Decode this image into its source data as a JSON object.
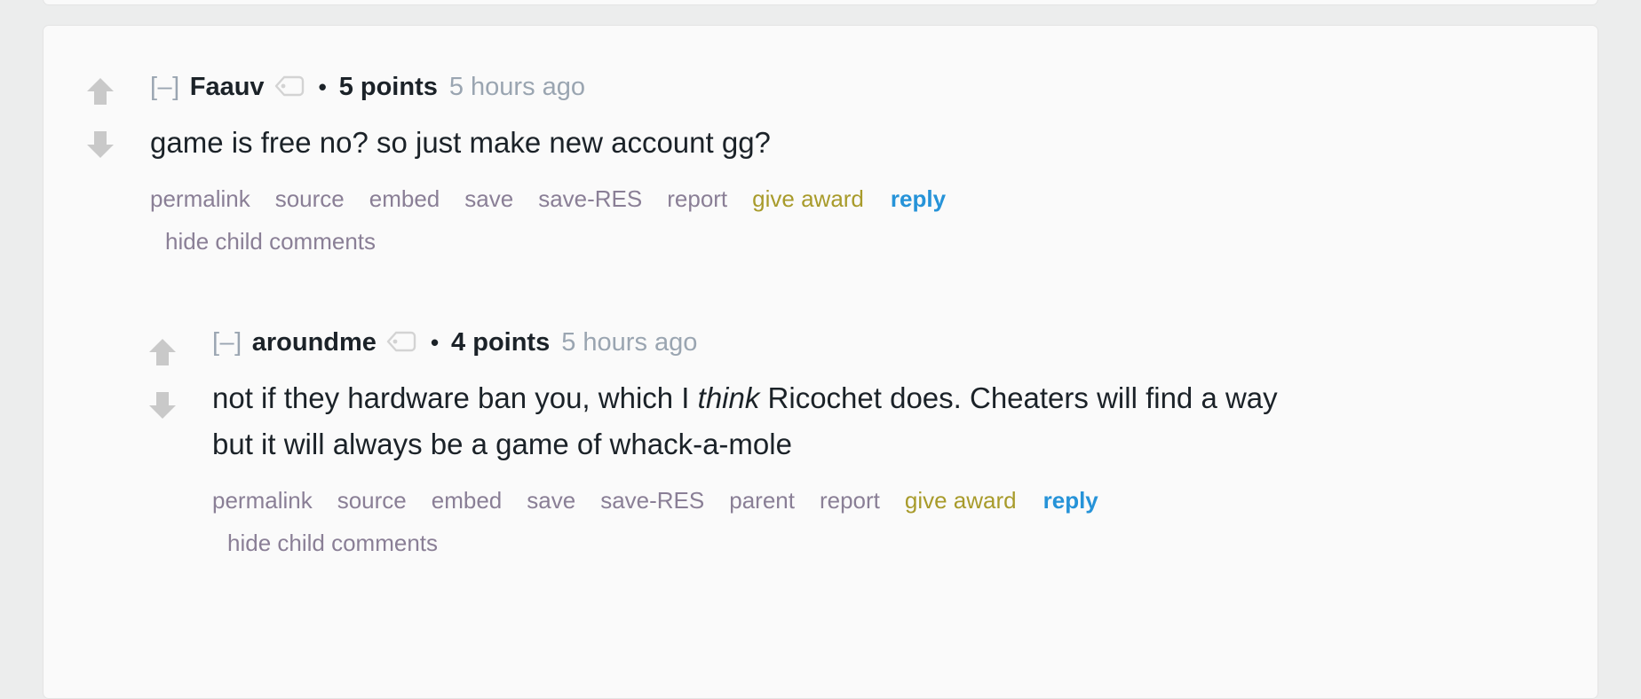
{
  "theme": {
    "page_background": "#eceded",
    "card_background": "#fafafa",
    "card_border": "#e4e4e4",
    "text_color": "#1b2228",
    "muted_link_color": "#8a7f96",
    "timestamp_color": "#9aa5b1",
    "award_link_color": "#a89b2b",
    "reply_link_color": "#2693d8",
    "vote_arrow_color": "#c9c9c9"
  },
  "comments": [
    {
      "collapse_toggle": "[–]",
      "author": "Faauv",
      "flair_icon": "tag-icon",
      "bullet": "•",
      "points": "5 points",
      "timestamp": "5 hours ago",
      "body": "game is free no? so just make new account gg?",
      "upvote_icon": "upvote-arrow-icon",
      "downvote_icon": "downvote-arrow-icon",
      "actions": [
        "permalink",
        "source",
        "embed",
        "save",
        "save-RES",
        "report"
      ],
      "award_label": "give award",
      "reply_label": "reply",
      "hide_children_label": "hide child comments"
    },
    {
      "collapse_toggle": "[–]",
      "author": "aroundme",
      "flair_icon": "tag-icon",
      "bullet": "•",
      "points": "4 points",
      "timestamp": "5 hours ago",
      "body_part1": "not if they hardware ban you, which I ",
      "body_italic": "think",
      "body_part2": " Ricochet does. Cheaters will find a way but it will always be a game of whack-a-mole",
      "upvote_icon": "upvote-arrow-icon",
      "downvote_icon": "downvote-arrow-icon",
      "actions": [
        "permalink",
        "source",
        "embed",
        "save",
        "save-RES",
        "parent",
        "report"
      ],
      "award_label": "give award",
      "reply_label": "reply",
      "hide_children_label": "hide child comments"
    }
  ]
}
